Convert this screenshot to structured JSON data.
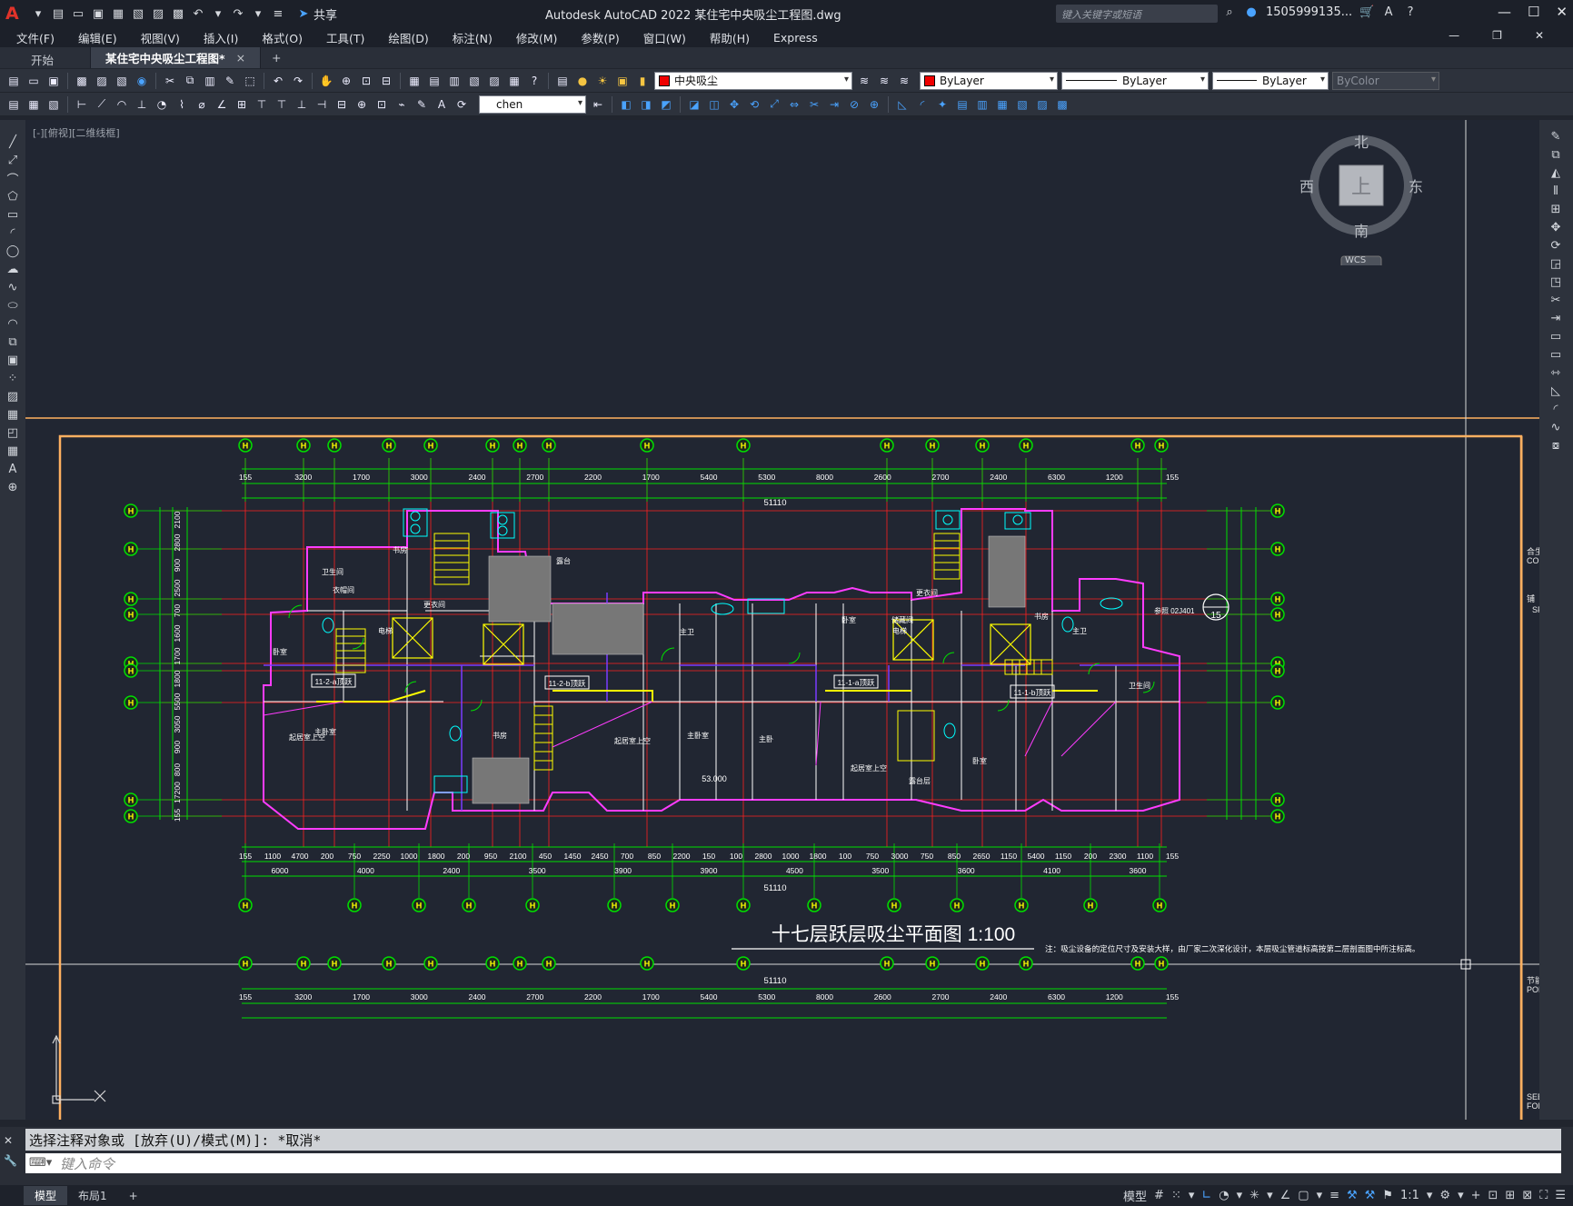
{
  "titlebar": {
    "share_label": "共享",
    "window_title": "Autodesk AutoCAD 2022    某住宅中央吸尘工程图.dwg",
    "search_placeholder": "键入关键字或短语",
    "user": "1505999135...",
    "logo_letter": "A"
  },
  "menu": {
    "items": [
      "文件(F)",
      "编辑(E)",
      "视图(V)",
      "插入(I)",
      "格式(O)",
      "工具(T)",
      "绘图(D)",
      "标注(N)",
      "修改(M)",
      "参数(P)",
      "窗口(W)",
      "帮助(H)",
      "Express"
    ]
  },
  "tabs": {
    "start": "开始",
    "active": "某住宅中央吸尘工程图*",
    "close": "×",
    "add": "+"
  },
  "toolbar": {
    "layer_name": "中央吸尘",
    "color": "ByLayer",
    "linetype": "ByLayer",
    "lineweight": "ByLayer",
    "plotstyle": "ByColor",
    "text_style": "chen"
  },
  "viewport": {
    "label": "[-][俯视][二维线框]",
    "wcs": "WCS"
  },
  "viewcube": {
    "north": "北",
    "south": "南",
    "east": "东",
    "west": "西",
    "top": "上"
  },
  "drawing": {
    "title": "十七层跃层吸尘平面图 1:100",
    "note": "注：吸尘设备的定位尺寸及安装大样，由厂家二次深化设计，本层吸尘管道标高按第二层剖面图中所注标高。",
    "overall_dim": "51110",
    "top_dims_row1": [
      "155",
      "3200",
      "1700",
      "3000",
      "2400",
      "2700",
      "2200",
      "1700",
      "5400",
      "5300",
      "8000",
      "2600",
      "2700",
      "2400",
      "6300",
      "1200",
      "155"
    ],
    "bottom_dims_row1": [
      "155",
      "1100",
      "4700",
      "200",
      "750",
      "2250",
      "1000",
      "1800",
      "200",
      "950",
      "2100",
      "450",
      "1450",
      "2450",
      "700",
      "850",
      "2200",
      "150",
      "100",
      "2800",
      "1000",
      "1800",
      "100",
      "750",
      "3000",
      "750",
      "850",
      "2650",
      "1150",
      "5400",
      "1150",
      "200",
      "2300",
      "1100",
      "155"
    ],
    "bottom_dims_row2": [
      "6000",
      "4000",
      "2400",
      "3500",
      "3900",
      "3900",
      "4500",
      "3500",
      "3600",
      "4100",
      "3600"
    ],
    "left_dims": [
      "2100",
      "2800",
      "900",
      "2500",
      "700",
      "1600",
      "1700",
      "1800",
      "5500",
      "3050",
      "900",
      "800",
      "17200",
      "155"
    ],
    "room_labels": [
      "卧室",
      "主卧室",
      "书房",
      "衣帽间",
      "更衣间",
      "露台",
      "电梯",
      "起居室上空",
      "起居室上空",
      "主卧室",
      "书房",
      "主卫",
      "卫生间",
      "卧室",
      "储藏间",
      "电梯",
      "起居室上空",
      "主卧",
      "卧室",
      "露台层",
      "更衣间",
      "主卫",
      "书房",
      "卫生间"
    ],
    "section_labels": [
      "11-2-a顶跃",
      "11-2-b顶跃",
      "11-1-a顶跃",
      "11-1-b顶跃"
    ],
    "elevation": "53.000",
    "detail_ref": "参照 02J401",
    "detail_no": "15",
    "side_labels": [
      "合生",
      "COO",
      "铺",
      "SF",
      "节能",
      "POR",
      "SEE",
      "FOR"
    ]
  },
  "command": {
    "history": "选择注释对象或 [放弃(U)/模式(M)]: *取消*",
    "placeholder": "键入命令"
  },
  "status": {
    "model_tab": "模型",
    "layout_tab": "布局1",
    "add": "+",
    "model_label": "模型",
    "scale": "1:1"
  },
  "colors": {
    "canvas_bg": "#212632",
    "grid_green": "#00e000",
    "axis_red": "#ff2020",
    "wall_magenta": "#ff3cff",
    "frame_orange": "#ffb060",
    "hatch_gray": "#b0b0b0",
    "vac_yellow": "#ffff00"
  }
}
